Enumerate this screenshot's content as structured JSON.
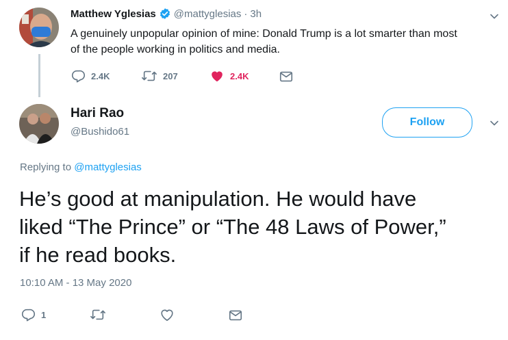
{
  "first_tweet": {
    "author_name": "Matthew Yglesias",
    "handle": "@mattyglesias",
    "separator": "·",
    "time": "3h",
    "text_line1": "A genuinely unpopular opinion of mine: Donald Trump is a lot smarter than most",
    "text_line2": "of the people working in politics and media.",
    "reply_count": "2.4K",
    "retweet_count": "207",
    "like_count": "2.4K"
  },
  "reply_tweet": {
    "author_name": "Hari Rao",
    "handle": "@Bushido61",
    "follow_label": "Follow",
    "replying_prefix": "Replying to",
    "replying_to": "@mattyglesias",
    "text_line1": "He’s good at manipulation. He would have",
    "text_line2": "liked “The Prince” or “The 48 Laws of Power,”",
    "text_line3": "if he read books.",
    "timestamp": "10:10 AM - 13 May 2020",
    "reply_count": "1"
  },
  "colors": {
    "accent": "#1da1f2",
    "like_red": "#e0245e",
    "muted": "#657786",
    "verified": "#1da1f2"
  },
  "icons": [
    "verified-badge-icon",
    "chevron-down-icon",
    "reply-icon",
    "retweet-icon",
    "heart-icon",
    "message-icon"
  ]
}
